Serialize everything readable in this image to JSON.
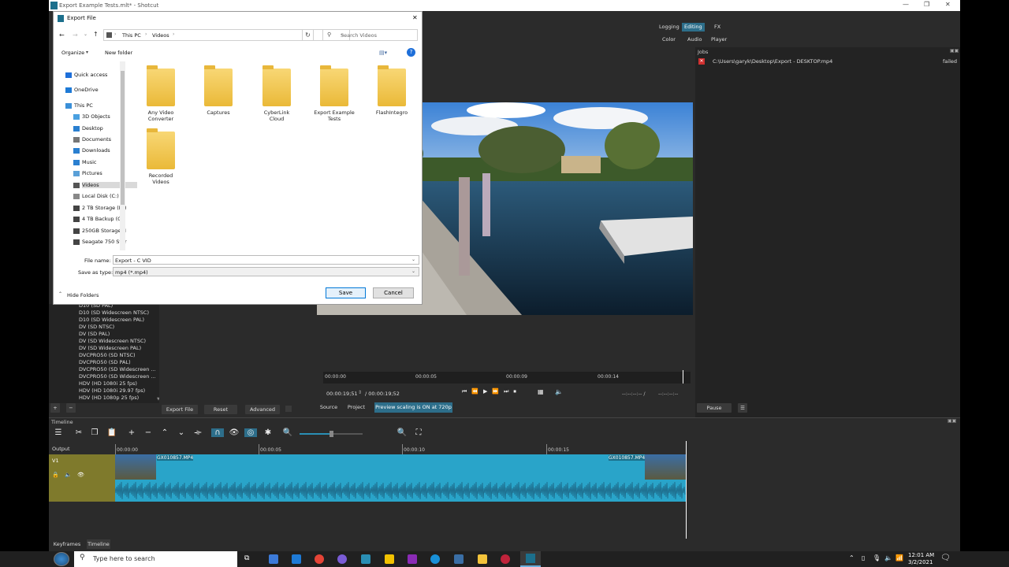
{
  "app": {
    "title": "Export Example Tests.mlt* - Shotcut",
    "layout_buttons": [
      "Logging",
      "Editing",
      "FX",
      "Color",
      "Audio",
      "Player"
    ],
    "active_layout": "Editing"
  },
  "jobs": {
    "header": "Jobs",
    "items": [
      {
        "path": "C:\\Users\\garyk\\Desktop\\Export - DESKTOP.mp4",
        "status": "failed"
      }
    ],
    "pause_label": "Pause"
  },
  "export_panel": {
    "presets": [
      "D10 (SD PAL)",
      "D10 (SD Widescreen NTSC)",
      "D10 (SD Widescreen PAL)",
      "DV (SD NTSC)",
      "DV (SD PAL)",
      "DV (SD Widescreen NTSC)",
      "DV (SD Widescreen PAL)",
      "DVCPRO50 (SD NTSC)",
      "DVCPRO50 (SD PAL)",
      "DVCPRO50 (SD Widescreen ...",
      "DVCPRO50 (SD Widescreen ...",
      "HDV (HD 1080i 25 fps)",
      "HDV (HD 1080i 29.97 fps)",
      "HDV (HD 1080p 25 fps)"
    ],
    "export_file_label": "Export File",
    "reset_label": "Reset",
    "advanced_label": "Advanced"
  },
  "player": {
    "ruler_ticks": [
      "00:00:00",
      "00:00:05",
      "00:00:09",
      "00:00:14"
    ],
    "current_time": "00:00:19;51",
    "total_time": "/ 00:00:19;52",
    "in_point": "--:--:--:-- /",
    "out_point": "--:--:--:--",
    "source_tab": "Source",
    "project_tab": "Project",
    "scaling_label": "Preview scaling is ON at 720p"
  },
  "timeline": {
    "header": "Timeline",
    "output_label": "Output",
    "track_name": "V1",
    "ruler_ticks": [
      "00:00:00",
      "00:00:05",
      "00:00:10",
      "00:00:15"
    ],
    "clip_name_start": "GX010857.MP4",
    "clip_name_end": "GX010857.MP4",
    "bottom_tabs": [
      "Keyframes",
      "Timeline"
    ]
  },
  "dialog": {
    "title": "Export File",
    "breadcrumb": [
      "This PC",
      "Videos"
    ],
    "search_placeholder": "Search Videos",
    "organize_label": "Organize",
    "new_folder_label": "New folder",
    "nav_items": [
      "Quick access",
      "OneDrive",
      "This PC",
      "3D Objects",
      "Desktop",
      "Documents",
      "Downloads",
      "Music",
      "Pictures",
      "Videos",
      "Local Disk (C:)",
      "2 TB Storage (D:)",
      "4 TB Backup (G:)",
      "250GB Storage (I",
      "Seagate 750 Stor"
    ],
    "selected_nav": "Videos",
    "folders": [
      "Any Video Converter",
      "Captures",
      "CyberLink Cloud",
      "Export Example Tests",
      "FlashIntegro",
      "Recorded Videos"
    ],
    "file_name_label": "File name:",
    "file_name_value": "Export - C VID",
    "save_type_label": "Save as type:",
    "save_type_value": "mp4 (*.mp4)",
    "hide_folders_label": "Hide Folders",
    "save_label": "Save",
    "cancel_label": "Cancel"
  },
  "taskbar": {
    "search_placeholder": "Type here to search",
    "time": "12:01 AM",
    "date": "3/2/2021"
  },
  "colors": {
    "accent": "#2a8fb5",
    "clip": "#29a4c9",
    "track_head": "#7f7a2c",
    "active_btn": "#2d6e8a"
  }
}
